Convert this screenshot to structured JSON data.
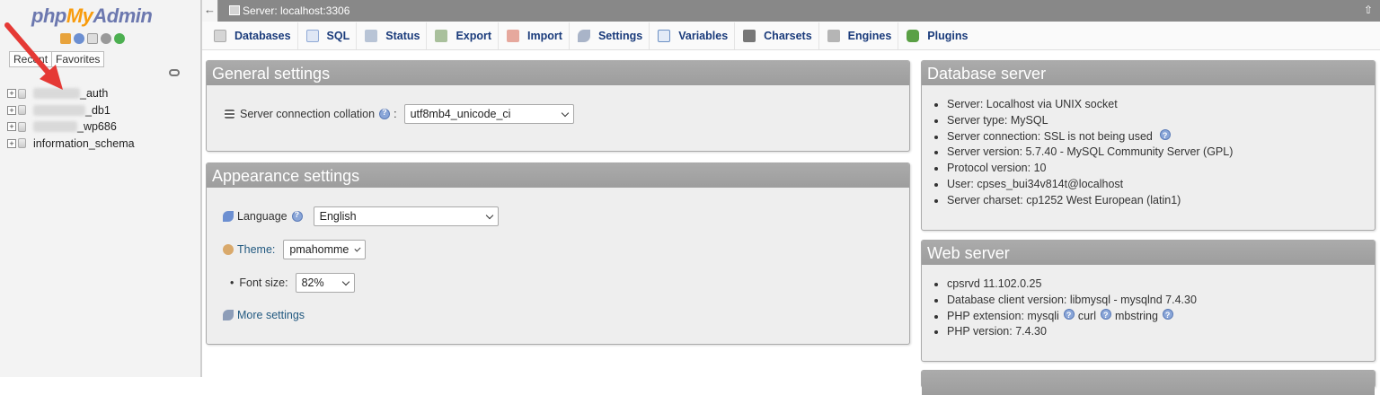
{
  "logo": {
    "php": "php",
    "my": "My",
    "admin": "Admin"
  },
  "nav": {
    "tabs": [
      "Recent",
      "Favorites"
    ],
    "databases": [
      {
        "label_suffix": "_auth",
        "redacted": true
      },
      {
        "label_suffix": "_db1",
        "redacted": true
      },
      {
        "label_suffix": "_wp686",
        "redacted": true
      },
      {
        "label": "information_schema",
        "redacted": false
      }
    ]
  },
  "serverbar": {
    "title": "Server: localhost:3306"
  },
  "tabs": [
    {
      "label": "Databases",
      "icon": "database-icon",
      "color": "#c8c8c8"
    },
    {
      "label": "SQL",
      "icon": "sql-icon",
      "color": "#8fa9d6"
    },
    {
      "label": "Status",
      "icon": "status-icon",
      "color": "#9aa7b8"
    },
    {
      "label": "Export",
      "icon": "export-icon",
      "color": "#7d9a6d"
    },
    {
      "label": "Import",
      "icon": "import-icon",
      "color": "#d27a6a"
    },
    {
      "label": "Settings",
      "icon": "wrench-icon",
      "color": "#7a8aa6"
    },
    {
      "label": "Variables",
      "icon": "variables-icon",
      "color": "#6c90c4"
    },
    {
      "label": "Charsets",
      "icon": "charsets-icon",
      "color": "#777777"
    },
    {
      "label": "Engines",
      "icon": "engines-icon",
      "color": "#9a9a9a"
    },
    {
      "label": "Plugins",
      "icon": "plugin-icon",
      "color": "#5aa045"
    }
  ],
  "general": {
    "title": "General settings",
    "collation_label": "Server connection collation",
    "collation_value": "utf8mb4_unicode_ci"
  },
  "appearance": {
    "title": "Appearance settings",
    "language_label": "Language",
    "language_value": "English",
    "theme_label": "Theme:",
    "theme_value": "pmahomme",
    "fontsize_label": "Font size:",
    "fontsize_value": "82%",
    "more_settings": "More settings"
  },
  "dbserver": {
    "title": "Database server",
    "items": [
      "Server: Localhost via UNIX socket",
      "Server type: MySQL",
      "Server connection: SSL is not being used",
      "Server version: 5.7.40 - MySQL Community Server (GPL)",
      "Protocol version: 10",
      "User: cpses_bui34v814t@localhost",
      "Server charset: cp1252 West European (latin1)"
    ]
  },
  "webserver": {
    "title": "Web server",
    "items": [
      "cpsrvd 11.102.0.25",
      "Database client version: libmysql - mysqlnd 7.4.30",
      "PHP extension: mysqli",
      "curl",
      "mbstring",
      "PHP version: 7.4.30"
    ]
  },
  "colors": {
    "accent_orange": "#f89c0e",
    "logo_blue": "#6c78af",
    "tab_text": "#1a3b7b",
    "arrow_red": "#e53935"
  }
}
